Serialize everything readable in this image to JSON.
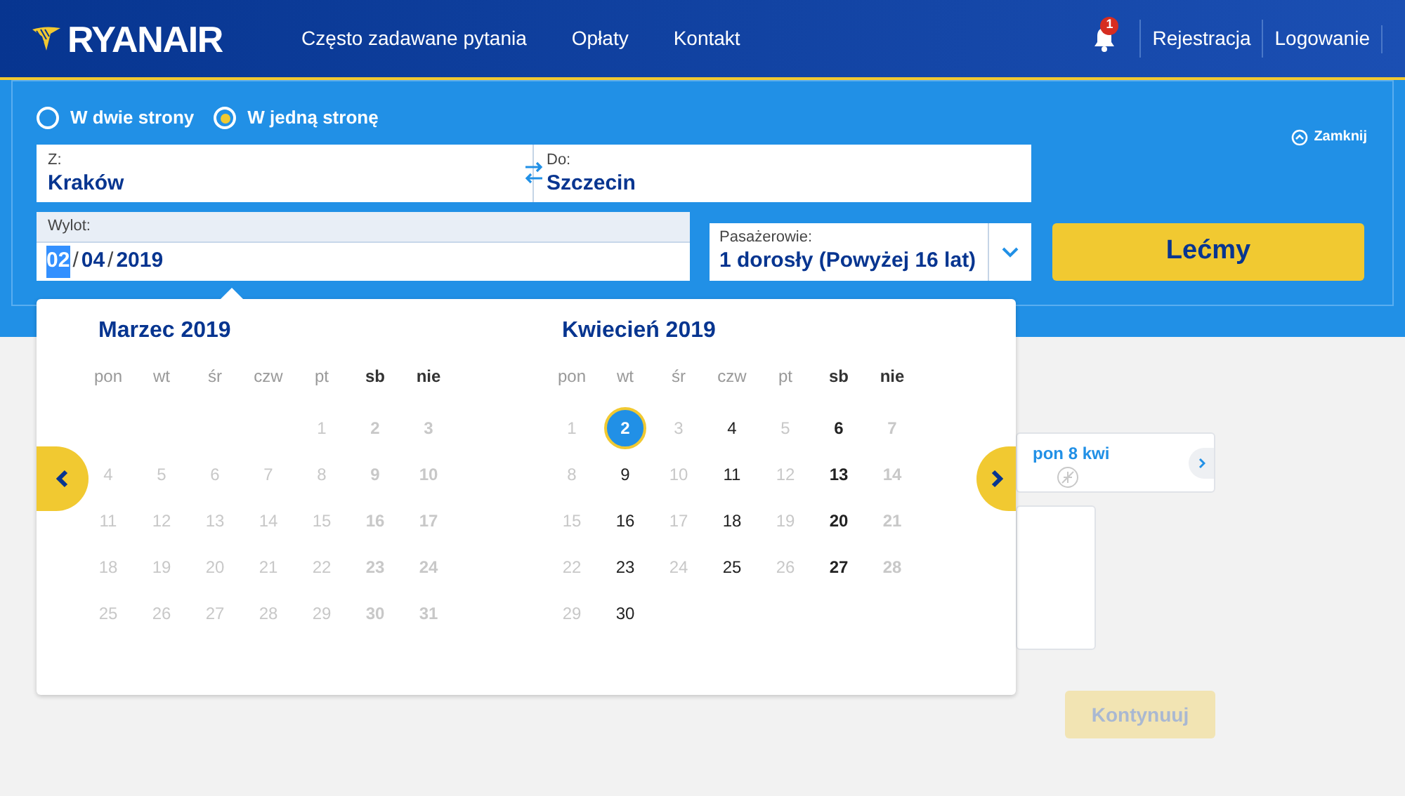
{
  "header": {
    "logo": "RYANAIR",
    "nav": [
      "Często zadawane pytania",
      "Opłaty",
      "Kontakt"
    ],
    "notifications": "1",
    "account_links": [
      "Rejestracja",
      "Logowanie"
    ]
  },
  "search": {
    "trip_types": [
      {
        "label": "W dwie strony",
        "selected": false
      },
      {
        "label": "W jedną stronę",
        "selected": true
      }
    ],
    "close": "Zamknij",
    "from": {
      "label": "Z:",
      "value": "Kraków"
    },
    "to": {
      "label": "Do:",
      "value": "Szczecin"
    },
    "departure": {
      "label": "Wylot:",
      "segments": [
        {
          "text": "02",
          "highlighted": true
        },
        {
          "text": "04",
          "highlighted": false
        },
        {
          "text": "2019",
          "highlighted": false
        }
      ],
      "separator": "/"
    },
    "passengers": {
      "label": "Pasażerowie:",
      "value": "1 dorosły (Powyżej 16 lat)"
    },
    "submit": "Lećmy"
  },
  "calendar": {
    "months": [
      {
        "title": "Marzec 2019",
        "weekdays": [
          "pon",
          "wt",
          "śr",
          "czw",
          "pt",
          "sb",
          "nie"
        ],
        "weeks": [
          {
            "aligned_end": true,
            "days": [
              {
                "day": "1",
                "available": false,
                "selected": false
              },
              {
                "day": "2",
                "available": false,
                "selected": false
              },
              {
                "day": "3",
                "available": false,
                "selected": false
              }
            ]
          },
          [
            {
              "day": "4",
              "available": false,
              "selected": false
            },
            {
              "day": "5",
              "available": false,
              "selected": false
            },
            {
              "day": "6",
              "available": false,
              "selected": false
            },
            {
              "day": "7",
              "available": false,
              "selected": false
            },
            {
              "day": "8",
              "available": false,
              "selected": false
            },
            {
              "day": "9",
              "available": false,
              "selected": false
            },
            {
              "day": "10",
              "available": false,
              "selected": false
            }
          ],
          [
            {
              "day": "11",
              "available": false,
              "selected": false
            },
            {
              "day": "12",
              "available": false,
              "selected": false
            },
            {
              "day": "13",
              "available": false,
              "selected": false
            },
            {
              "day": "14",
              "available": false,
              "selected": false
            },
            {
              "day": "15",
              "available": false,
              "selected": false
            },
            {
              "day": "16",
              "available": false,
              "selected": false
            },
            {
              "day": "17",
              "available": false,
              "selected": false
            }
          ],
          [
            {
              "day": "18",
              "available": false,
              "selected": false
            },
            {
              "day": "19",
              "available": false,
              "selected": false
            },
            {
              "day": "20",
              "available": false,
              "selected": false
            },
            {
              "day": "21",
              "available": false,
              "selected": false
            },
            {
              "day": "22",
              "available": false,
              "selected": false
            },
            {
              "day": "23",
              "available": false,
              "selected": false
            },
            {
              "day": "24",
              "available": false,
              "selected": false
            }
          ],
          [
            {
              "day": "25",
              "available": false,
              "selected": false
            },
            {
              "day": "26",
              "available": false,
              "selected": false
            },
            {
              "day": "27",
              "available": false,
              "selected": false
            },
            {
              "day": "28",
              "available": false,
              "selected": false
            },
            {
              "day": "29",
              "available": false,
              "selected": false
            },
            {
              "day": "30",
              "available": false,
              "selected": false
            },
            {
              "day": "31",
              "available": false,
              "selected": false
            }
          ]
        ]
      },
      {
        "title": "Kwiecień 2019",
        "weekdays": [
          "pon",
          "wt",
          "śr",
          "czw",
          "pt",
          "sb",
          "nie"
        ],
        "weeks": [
          [
            {
              "day": "1",
              "available": false,
              "selected": false
            },
            {
              "day": "2",
              "available": true,
              "selected": true
            },
            {
              "day": "3",
              "available": false,
              "selected": false
            },
            {
              "day": "4",
              "available": true,
              "selected": false
            },
            {
              "day": "5",
              "available": false,
              "selected": false
            },
            {
              "day": "6",
              "available": true,
              "selected": false
            },
            {
              "day": "7",
              "available": false,
              "selected": false
            }
          ],
          [
            {
              "day": "8",
              "available": false,
              "selected": false
            },
            {
              "day": "9",
              "available": true,
              "selected": false
            },
            {
              "day": "10",
              "available": false,
              "selected": false
            },
            {
              "day": "11",
              "available": true,
              "selected": false
            },
            {
              "day": "12",
              "available": false,
              "selected": false
            },
            {
              "day": "13",
              "available": true,
              "selected": false
            },
            {
              "day": "14",
              "available": false,
              "selected": false
            }
          ],
          [
            {
              "day": "15",
              "available": false,
              "selected": false
            },
            {
              "day": "16",
              "available": true,
              "selected": false
            },
            {
              "day": "17",
              "available": false,
              "selected": false
            },
            {
              "day": "18",
              "available": true,
              "selected": false
            },
            {
              "day": "19",
              "available": false,
              "selected": false
            },
            {
              "day": "20",
              "available": true,
              "selected": false
            },
            {
              "day": "21",
              "available": false,
              "selected": false
            }
          ],
          [
            {
              "day": "22",
              "available": false,
              "selected": false
            },
            {
              "day": "23",
              "available": true,
              "selected": false
            },
            {
              "day": "24",
              "available": false,
              "selected": false
            },
            {
              "day": "25",
              "available": true,
              "selected": false
            },
            {
              "day": "26",
              "available": false,
              "selected": false
            },
            {
              "day": "27",
              "available": true,
              "selected": false
            },
            {
              "day": "28",
              "available": false,
              "selected": false
            }
          ],
          [
            {
              "day": "29",
              "available": false,
              "selected": false
            },
            {
              "day": "30",
              "available": true,
              "selected": false
            }
          ]
        ]
      }
    ]
  },
  "background": {
    "date_card": "pon 8 kwi",
    "continue": "Kontynuuj"
  }
}
